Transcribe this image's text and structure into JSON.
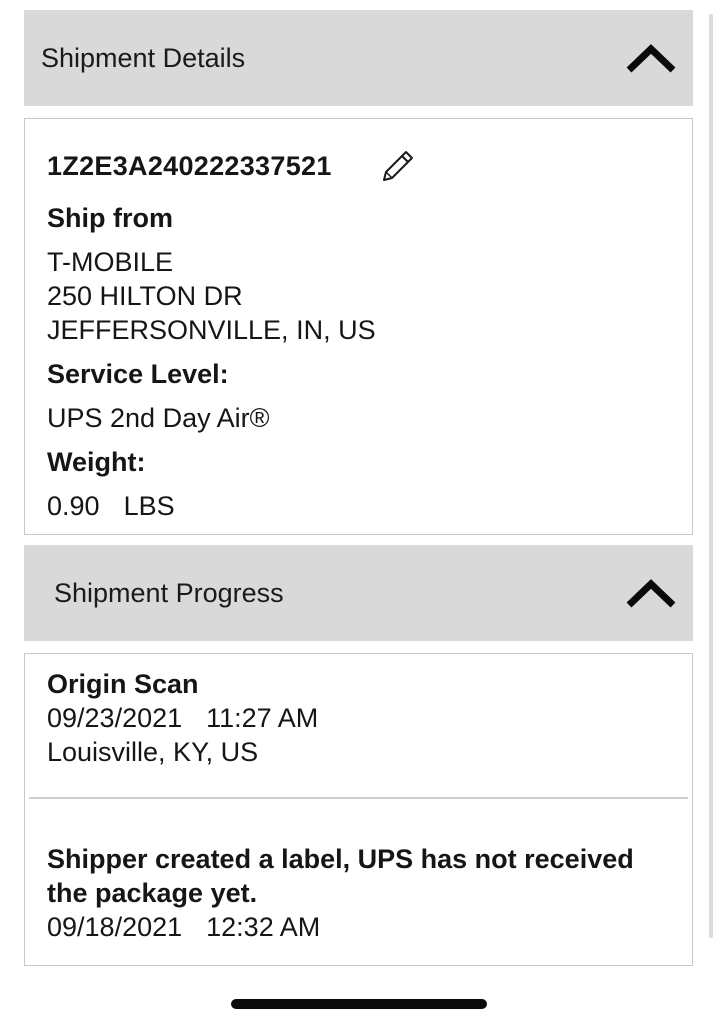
{
  "details": {
    "header_title": "Shipment Details",
    "collapse_icon": "chevron-up-icon",
    "tracking_number": "1Z2E3A240222337521",
    "edit_icon": "pencil-icon",
    "ship_from_label": "Ship from",
    "ship_from_lines": [
      "T-MOBILE",
      "250 HILTON DR",
      "JEFFERSONVILLE, IN, US"
    ],
    "service_level_label": "Service Level:",
    "service_level_value": "UPS 2nd Day Air®",
    "weight_label": "Weight:",
    "weight_value": "0.90",
    "weight_unit": "LBS"
  },
  "progress": {
    "header_title": "Shipment Progress",
    "collapse_icon": "chevron-up-icon",
    "events": [
      {
        "title": "Origin Scan",
        "date": "09/23/2021",
        "time": "11:27 AM",
        "location": "Louisville, KY, US"
      },
      {
        "title_line1": "Shipper created a label, UPS has not received",
        "title_line2": "the package yet.",
        "date": "09/18/2021",
        "time": "12:32 AM"
      }
    ]
  },
  "colors": {
    "header_bg": "#d9d9d9",
    "card_border": "#c8c8c8",
    "text": "#161616"
  }
}
